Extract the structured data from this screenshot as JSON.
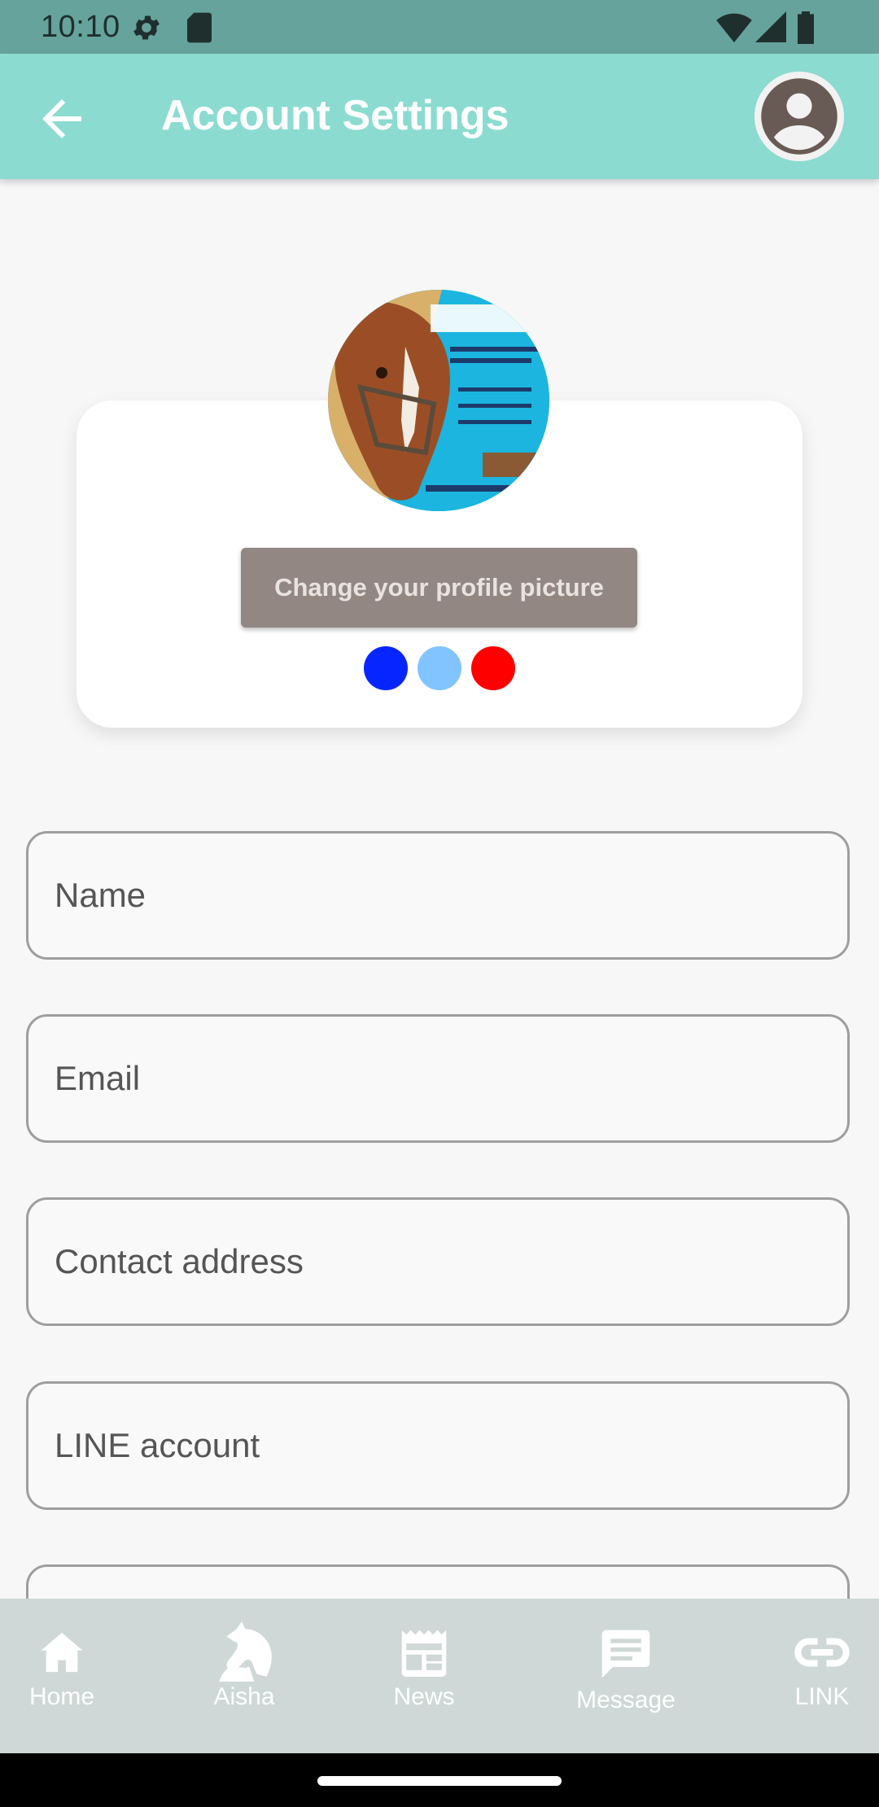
{
  "status_bar": {
    "time": "10:10",
    "icons": [
      "settings-icon",
      "sd-card-icon",
      "wifi-icon",
      "signal-icon",
      "battery-icon"
    ]
  },
  "app_bar": {
    "title": "Account Settings",
    "back_icon": "arrow-back-icon",
    "account_icon": "account-circle-icon"
  },
  "profile": {
    "photo_description_icon": "horse-profile-photo",
    "change_button_label": "Change your profile picture",
    "colors": [
      "#0726ff",
      "#82c4ff",
      "#ff0000"
    ]
  },
  "form": {
    "fields": [
      {
        "placeholder": "Name"
      },
      {
        "placeholder": "Email"
      },
      {
        "placeholder": "Contact address"
      },
      {
        "placeholder": "LINE account"
      }
    ]
  },
  "bottom_nav": {
    "items": [
      {
        "label": "Home",
        "icon": "home-icon"
      },
      {
        "label": "Aisha",
        "icon": "horse-icon"
      },
      {
        "label": "News",
        "icon": "news-icon"
      },
      {
        "label": "Message",
        "icon": "message-icon"
      },
      {
        "label": "LINK",
        "icon": "link-icon"
      }
    ]
  },
  "colors": {
    "status_bar": "#66a39c",
    "app_bar": "#8bdbd1",
    "button": "#938784",
    "nav_bar": "#cfd8d6"
  }
}
